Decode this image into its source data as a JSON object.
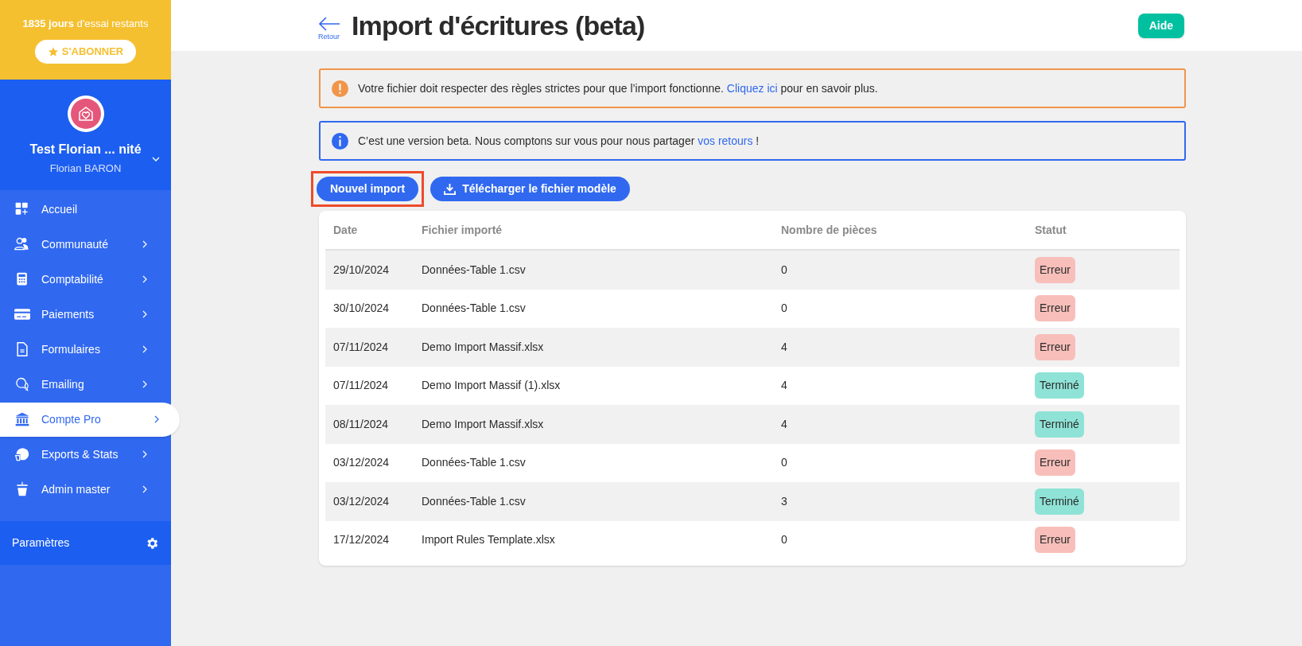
{
  "trial": {
    "text": "**1835 jours** d'essai restants",
    "subscribe": "S'ABONNER"
  },
  "profile": {
    "org": "Test Florian ... nité",
    "user": "Florian BARON"
  },
  "menu": [
    {
      "label": "Accueil",
      "selected": false,
      "chevron": false
    },
    {
      "label": "Communauté",
      "selected": false,
      "chevron": true
    },
    {
      "label": "Comptabilité",
      "selected": false,
      "chevron": true
    },
    {
      "label": "Paiements",
      "selected": false,
      "chevron": true
    },
    {
      "label": "Formulaires",
      "selected": false,
      "chevron": true
    },
    {
      "label": "Emailing",
      "selected": false,
      "chevron": true
    },
    {
      "label": "Compte Pro",
      "selected": true,
      "chevron": true
    },
    {
      "label": "Exports & Stats",
      "selected": false,
      "chevron": true
    },
    {
      "label": "Admin master",
      "selected": false,
      "chevron": true
    }
  ],
  "settings": {
    "label": "Paramètres"
  },
  "header": {
    "back": "Retour",
    "title": "Import d'écritures (beta)",
    "help": "Aide"
  },
  "alerts": [
    {
      "kind": "warning",
      "text": "Votre fichier doit respecter des règles strictes pour que l’import fonctionne. ",
      "link": "Cliquez ici",
      "after": " pour en savoir plus."
    },
    {
      "kind": "info",
      "text": "C’est une version beta. Nous comptons sur vous pour nous partager ",
      "link": "vos retours",
      "after": " !"
    }
  ],
  "actions": [
    {
      "kind": "plain",
      "label": "Nouvel import",
      "highlighted": true
    },
    {
      "kind": "download",
      "label": "Télécharger le fichier modèle",
      "highlighted": false
    }
  ],
  "table": {
    "columns": [
      "Date",
      "Fichier importé",
      "Nombre de pièces",
      "Statut"
    ],
    "rows": [
      {
        "date": "29/10/2024",
        "file": "Données-Table 1.csv",
        "count": "0",
        "status": "Erreur",
        "kind": "error"
      },
      {
        "date": "30/10/2024",
        "file": "Données-Table 1.csv",
        "count": "0",
        "status": "Erreur",
        "kind": "error"
      },
      {
        "date": "07/11/2024",
        "file": "Demo Import Massif.xlsx",
        "count": "4",
        "status": "Erreur",
        "kind": "error"
      },
      {
        "date": "07/11/2024",
        "file": "Demo Import Massif (1).xlsx",
        "count": "4",
        "status": "Terminé",
        "kind": "done"
      },
      {
        "date": "08/11/2024",
        "file": "Demo Import Massif.xlsx",
        "count": "4",
        "status": "Terminé",
        "kind": "done"
      },
      {
        "date": "03/12/2024",
        "file": "Données-Table 1.csv",
        "count": "0",
        "status": "Erreur",
        "kind": "error"
      },
      {
        "date": "03/12/2024",
        "file": "Données-Table 1.csv",
        "count": "3",
        "status": "Terminé",
        "kind": "done"
      },
      {
        "date": "17/12/2024",
        "file": "Import Rules Template.xlsx",
        "count": "0",
        "status": "Erreur",
        "kind": "error"
      }
    ]
  }
}
